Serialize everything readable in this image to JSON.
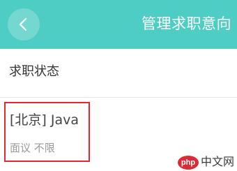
{
  "header": {
    "title": "管理求职意向",
    "back_icon": "chevron-left-icon",
    "background_color": "#4ecdc4"
  },
  "status_section": {
    "label": "求职状态"
  },
  "job_intent": {
    "title": "[北京] Java",
    "meta": "面议 不限",
    "highlight_color": "#e8262f"
  },
  "watermark": {
    "badge": "php",
    "text": "中文网"
  }
}
